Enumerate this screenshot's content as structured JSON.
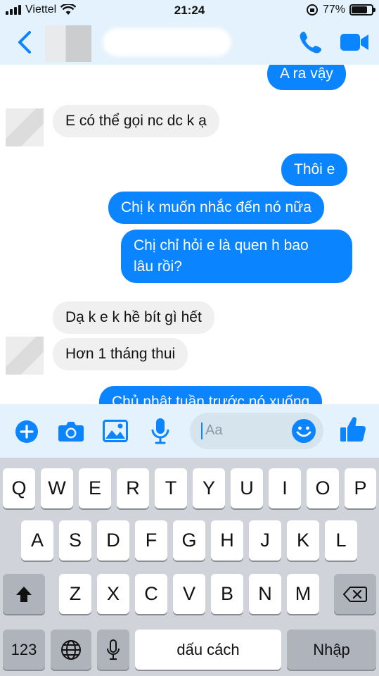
{
  "status_bar": {
    "carrier": "Viettel",
    "time": "21:24",
    "battery_percent": "77%",
    "battery_level": 0.77
  },
  "header": {
    "back_icon": "chevron-left-icon",
    "call_icon": "phone-icon",
    "video_icon": "video-camera-icon"
  },
  "messages": [
    {
      "side": "out",
      "text": "A ra vậy"
    },
    {
      "side": "in",
      "text": "E có thể gọi nc dc k ạ"
    },
    {
      "side": "out",
      "text": "Thôi e"
    },
    {
      "side": "out",
      "text": "Chị k muốn nhắc đến nó nữa"
    },
    {
      "side": "out",
      "text_line1": "Chị chỉ hỏi e là quen h bao",
      "text_line2": "lâu rồi?"
    },
    {
      "side": "in",
      "text": "Dạ k e k hề bít gì hết"
    },
    {
      "side": "in",
      "text": "Hơn 1 tháng thui"
    },
    {
      "side": "out",
      "text": "Chủ nhật tuần trước nó xuống"
    }
  ],
  "composer": {
    "placeholder": "Aa",
    "icons": [
      "plus-icon",
      "camera-icon",
      "image-icon",
      "microphone-icon",
      "emoji-icon",
      "thumbs-up-icon"
    ]
  },
  "keyboard": {
    "row1": [
      "Q",
      "W",
      "E",
      "R",
      "T",
      "Y",
      "U",
      "I",
      "O",
      "P"
    ],
    "row2": [
      "A",
      "S",
      "D",
      "F",
      "G",
      "H",
      "J",
      "K",
      "L"
    ],
    "row3": [
      "Z",
      "X",
      "C",
      "V",
      "B",
      "N",
      "M"
    ],
    "numbers_key": "123",
    "space_key": "dấu cách",
    "return_key": "Nhập"
  },
  "colors": {
    "accent": "#0a84ff",
    "header_bg": "#e3f2fc",
    "incoming_bubble": "#f0f0f0",
    "keyboard_bg": "#d0d4da"
  }
}
